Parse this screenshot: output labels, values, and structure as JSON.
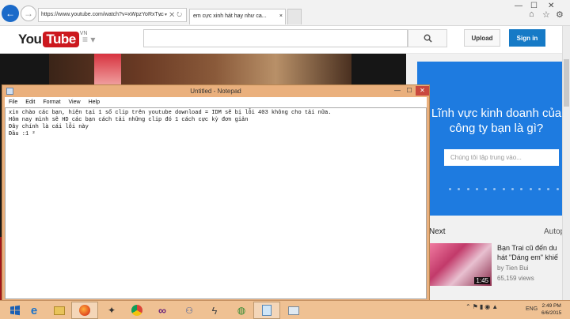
{
  "browser": {
    "url": "https://www.youtube.com/watch?v=xWpzYoRxTvc",
    "tab_title": "em cực xinh hát hay như ca...",
    "tab_close": "×",
    "new_tab": "",
    "window_controls": [
      "—",
      "☐",
      "✕"
    ]
  },
  "youtube": {
    "logo_you": "You",
    "logo_tube": "Tube",
    "logo_region": "VN",
    "upload_label": "Upload",
    "signin_label": "Sign in",
    "search_placeholder": ""
  },
  "ad": {
    "headline": "Lĩnh vực kinh doanh của công ty bạn là gì?",
    "input_placeholder": "Chúng tôi tập trung vào...",
    "color": "#1e7be0"
  },
  "sidebar": {
    "next_label": "Next",
    "autoplay_label": "Autop",
    "next_video": {
      "title_line1": "Bạn Trai cũ đến du",
      "title_line2": "hát \"Dáng em\" khiế",
      "channel": "by Tien Bui",
      "views": "65,159 views",
      "duration": "1:45"
    }
  },
  "notepad": {
    "title": "Untitled - Notepad",
    "menu": [
      "File",
      "Edit",
      "Format",
      "View",
      "Help"
    ],
    "lines": [
      "xin chào các bạn, hiện tại 1 số clip trên youtube download = IDM sẽ bị lỗi 403 không cho tải nữa.",
      "Hôm nay mình sẽ HD các bạn cách tải những clip đó 1 cách cực kỳ đơn giản",
      "Đây chính là cái lỗi này",
      "Đầu :1 ²"
    ]
  },
  "taskbar": {
    "icons": [
      "windows-logo-icon",
      "ie-icon",
      "file-explorer-icon",
      "firefox-icon",
      "chrome-icon",
      "visual-studio-icon",
      "connections-icon",
      "lightning-icon",
      "torrent-icon",
      "notepad-icon",
      "window-icon"
    ],
    "language": "ENG",
    "time": "2:49 PM",
    "date": "6/6/2015"
  }
}
